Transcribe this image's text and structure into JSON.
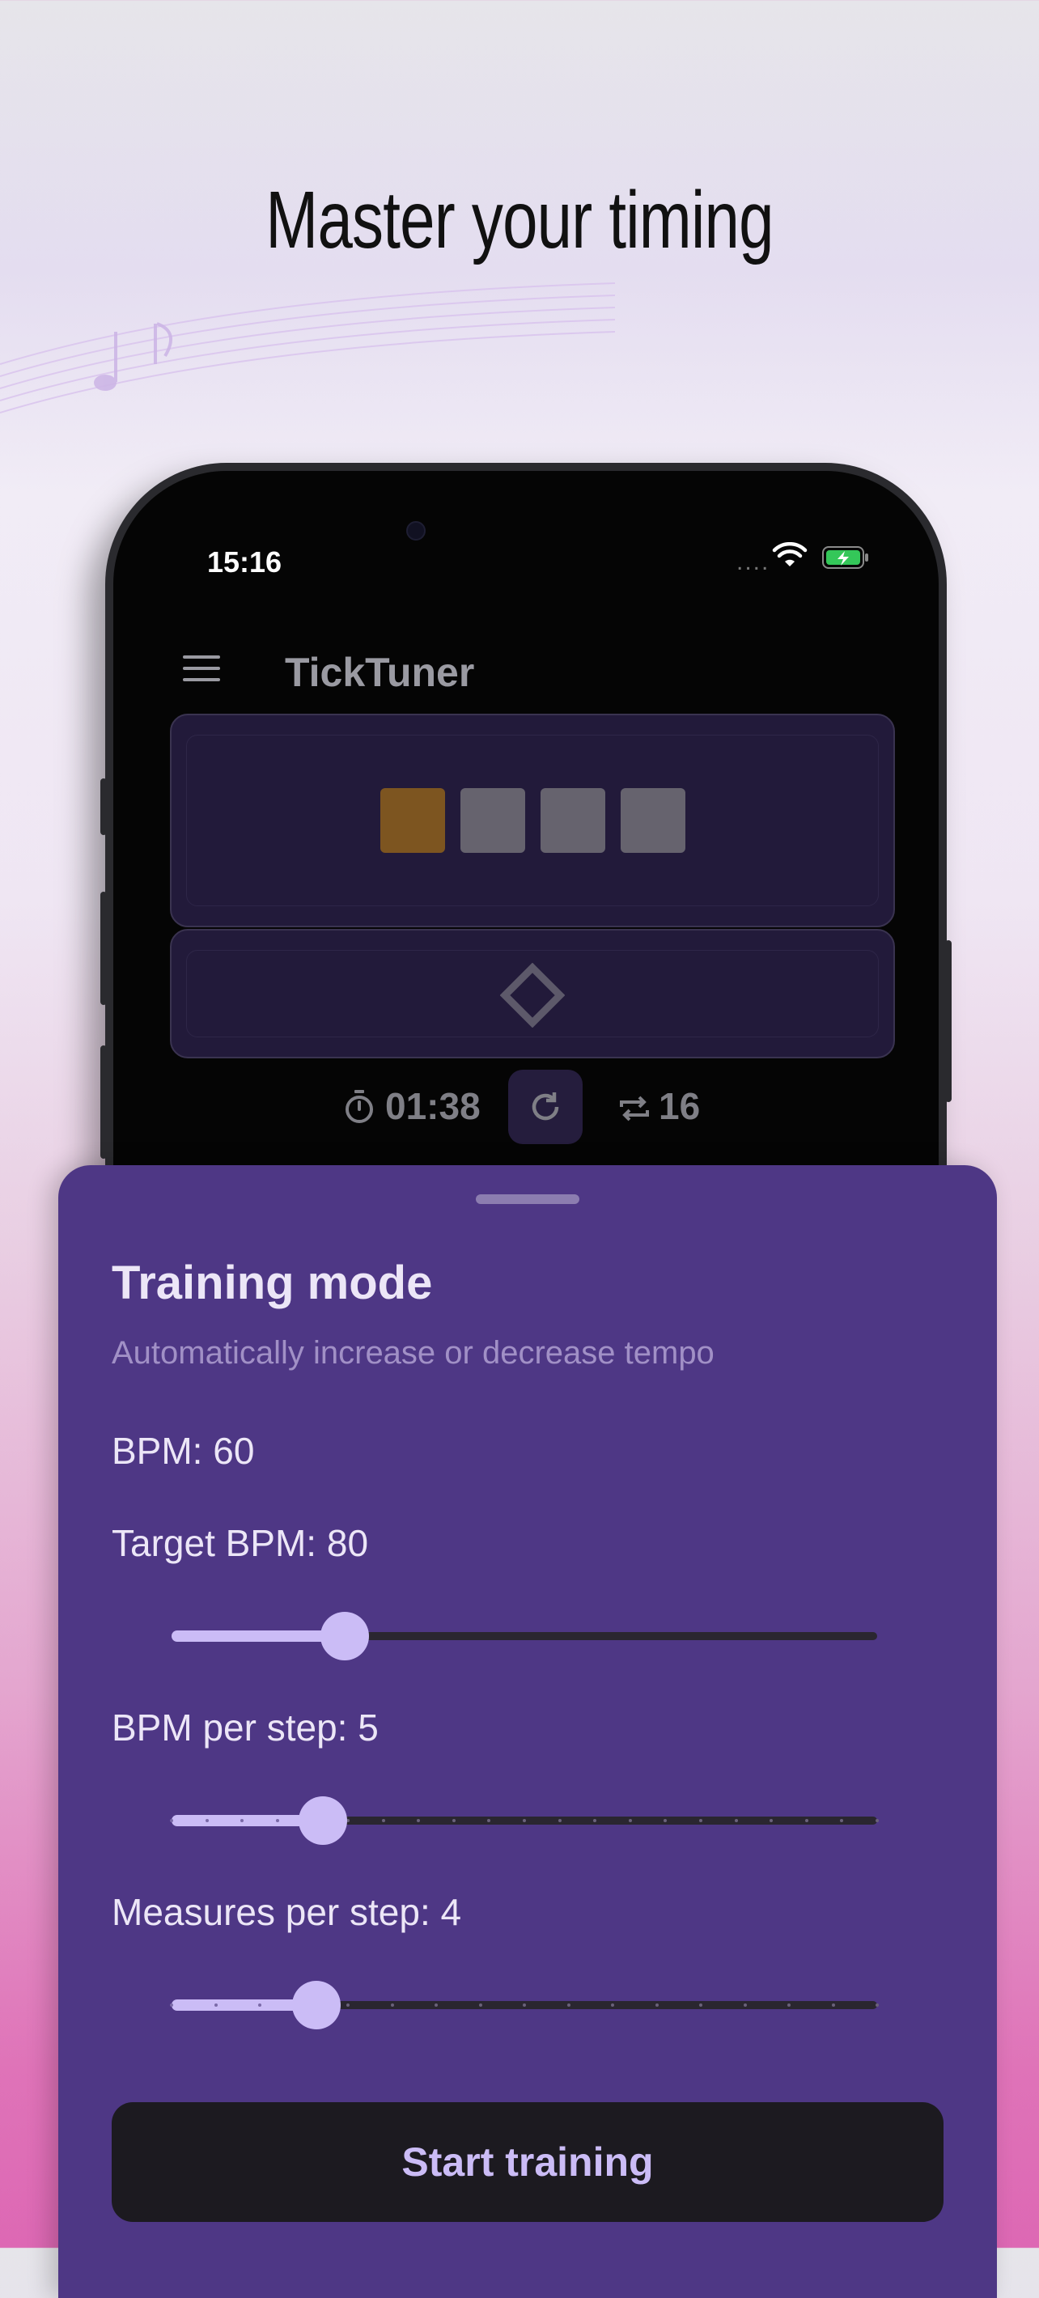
{
  "headline": "Master your timing",
  "status_bar": {
    "time": "15:16",
    "signal": "...."
  },
  "app": {
    "title": "TickTuner",
    "beats": {
      "count": 4,
      "active_index": 0
    },
    "timer": "01:38",
    "repeat_count": "16"
  },
  "sheet": {
    "title": "Training mode",
    "subtitle": "Automatically increase or decrease tempo",
    "bpm_label": "BPM: 60",
    "target_bpm_label": "Target BPM: 80",
    "bpm_per_step_label": "BPM per step: 5",
    "measures_per_step_label": "Measures per step: 4",
    "start_button": "Start training"
  },
  "sliders": {
    "target_bpm": {
      "fraction": 0.245,
      "ticks": 0
    },
    "bpm_per_step": {
      "fraction": 0.215,
      "ticks": 20
    },
    "measures_per_step": {
      "fraction": 0.205,
      "ticks": 16
    }
  },
  "colors": {
    "accent": "#cbbcf6",
    "sheet_bg": "#4e3785",
    "beat_active": "#7d5520",
    "beat_inactive": "#66636e"
  }
}
